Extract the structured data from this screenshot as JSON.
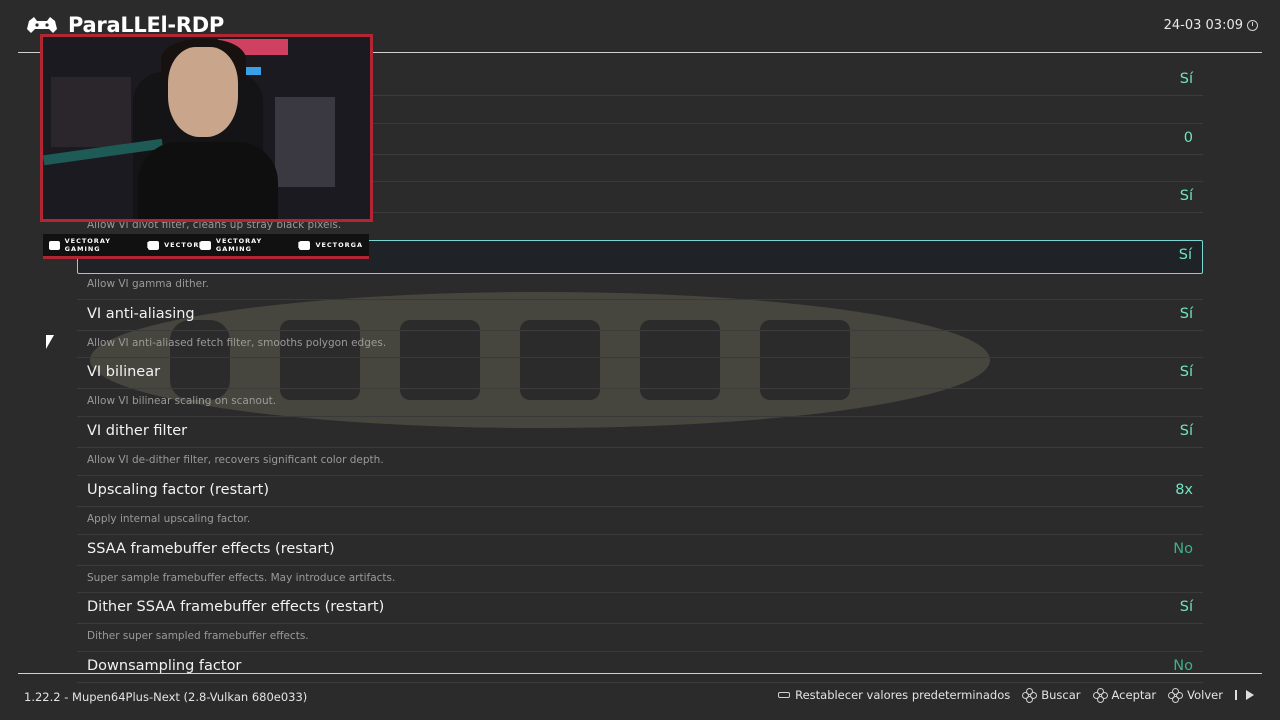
{
  "header": {
    "title": "ParaLLEl-RDP",
    "overlay_text": "VECTOR",
    "clock": "24-03 03:09"
  },
  "settings": [
    {
      "label": "",
      "value": "Sí",
      "desc": ""
    },
    {
      "label": "",
      "value": "0",
      "desc": ""
    },
    {
      "label": "",
      "value": "Sí",
      "desc": "Allow VI divot filter, cleans up stray black pixels."
    },
    {
      "label": "",
      "value": "Sí",
      "desc": "Allow VI gamma dither."
    },
    {
      "label": "VI anti-aliasing",
      "value": "Sí",
      "desc": "Allow VI anti-aliased fetch filter, smooths polygon edges."
    },
    {
      "label": "VI bilinear",
      "value": "Sí",
      "desc": "Allow VI bilinear scaling on scanout."
    },
    {
      "label": "VI dither filter",
      "value": "Sí",
      "desc": "Allow VI de-dither filter, recovers significant color depth."
    },
    {
      "label": "Upscaling factor (restart)",
      "value": "8x",
      "desc": "Apply internal upscaling factor."
    },
    {
      "label": "SSAA framebuffer effects (restart)",
      "value": "No",
      "desc": "Super sample framebuffer effects. May introduce artifacts."
    },
    {
      "label": "Dither SSAA framebuffer effects (restart)",
      "value": "Sí",
      "desc": "Dither super sampled framebuffer effects."
    },
    {
      "label": "Downsampling factor",
      "value": "No",
      "desc": ""
    }
  ],
  "webcam": {
    "social": [
      {
        "icon": "youtube-icon",
        "text": "VECTORAY GAMING"
      },
      {
        "icon": "twitch-icon",
        "text": "VECTOR"
      },
      {
        "icon": "twitter-icon",
        "text": "VECTORAY GAMING"
      },
      {
        "icon": "instagram-icon",
        "text": "VECTORGA"
      }
    ]
  },
  "footer": {
    "version": "1.22.2 - Mupen64Plus-Next (2.8-Vulkan 680e033)",
    "actions": {
      "reset": "Restablecer valores predeterminados",
      "search": "Buscar",
      "accept": "Aceptar",
      "back": "Volver"
    }
  },
  "colors": {
    "accent_on": "#6fe6c3",
    "accent_off": "#3eb08e",
    "selection_border": "#7ad8d4",
    "webcam_frame": "#b22634"
  }
}
